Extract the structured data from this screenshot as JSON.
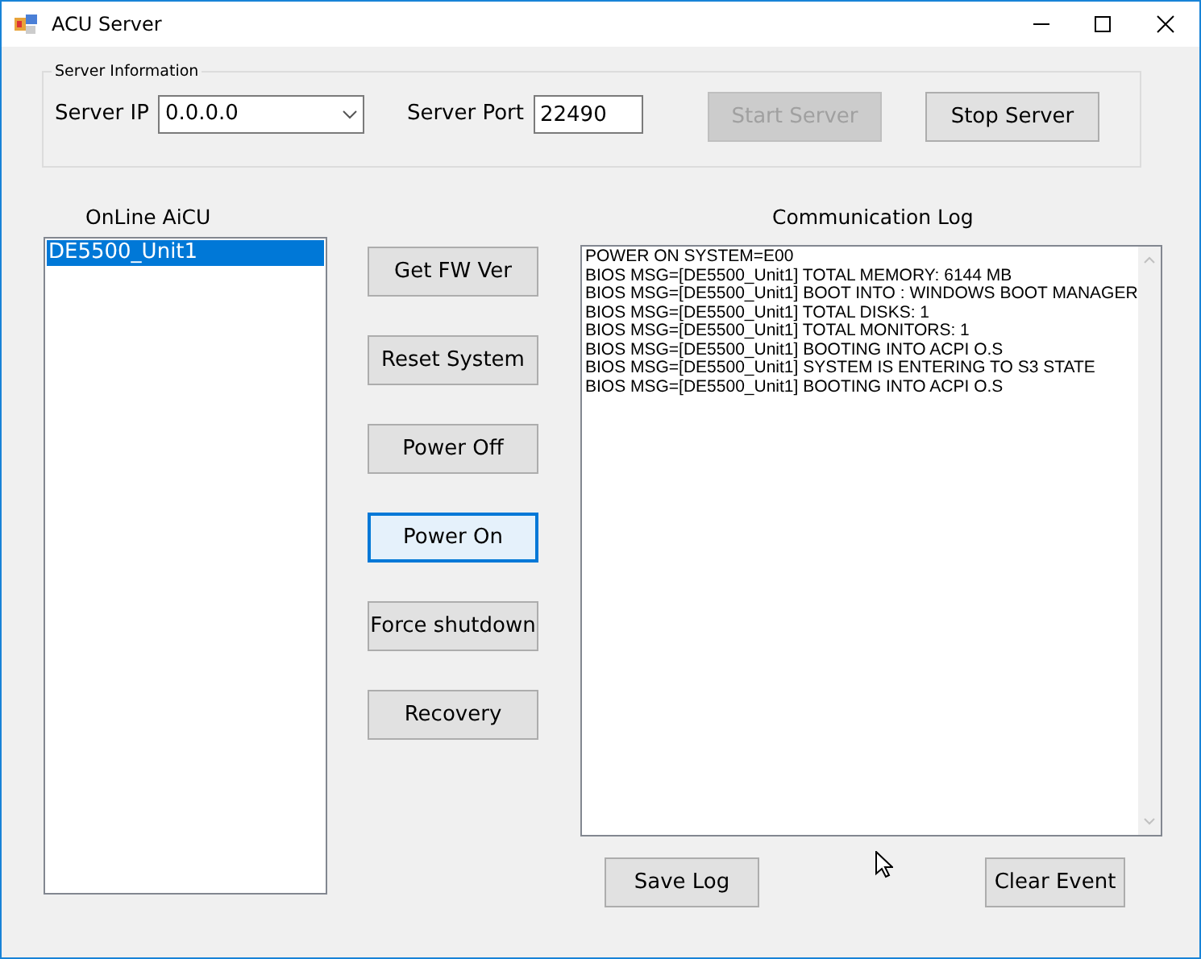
{
  "window": {
    "title": "ACU Server"
  },
  "server_information": {
    "title": "Server Information",
    "ip_label": "Server IP",
    "ip_value": "0.0.0.0",
    "port_label": "Server Port",
    "port_value": "22490",
    "buttons": [
      {
        "label": "Start Server",
        "disabled": true
      },
      {
        "label": "Stop Server",
        "disabled": false
      }
    ]
  },
  "online_aicu": {
    "title": "OnLine AiCU",
    "items": [
      {
        "label": "DE5500_Unit1",
        "selected": true
      }
    ]
  },
  "actions": [
    {
      "label": "Get FW Ver",
      "focused": false
    },
    {
      "label": "Reset System",
      "focused": false
    },
    {
      "label": "Power Off",
      "focused": false
    },
    {
      "label": "Power On",
      "focused": true
    },
    {
      "label": "Force shutdown",
      "focused": false
    },
    {
      "label": "Recovery",
      "focused": false
    }
  ],
  "communication_log": {
    "title": "Communication Log",
    "lines": [
      "POWER ON SYSTEM=E00",
      "BIOS MSG=[DE5500_Unit1] TOTAL MEMORY: 6144 MB",
      "BIOS MSG=[DE5500_Unit1] BOOT INTO : WINDOWS BOOT MANAGER",
      "BIOS MSG=[DE5500_Unit1] TOTAL DISKS: 1",
      "BIOS MSG=[DE5500_Unit1] TOTAL MONITORS: 1",
      "BIOS MSG=[DE5500_Unit1] BOOTING INTO ACPI O.S",
      "BIOS MSG=[DE5500_Unit1] SYSTEM IS ENTERING TO S3 STATE",
      "BIOS MSG=[DE5500_Unit1] BOOTING INTO ACPI O.S"
    ]
  },
  "bottom_buttons": [
    "Save Log",
    "Clear Event"
  ]
}
